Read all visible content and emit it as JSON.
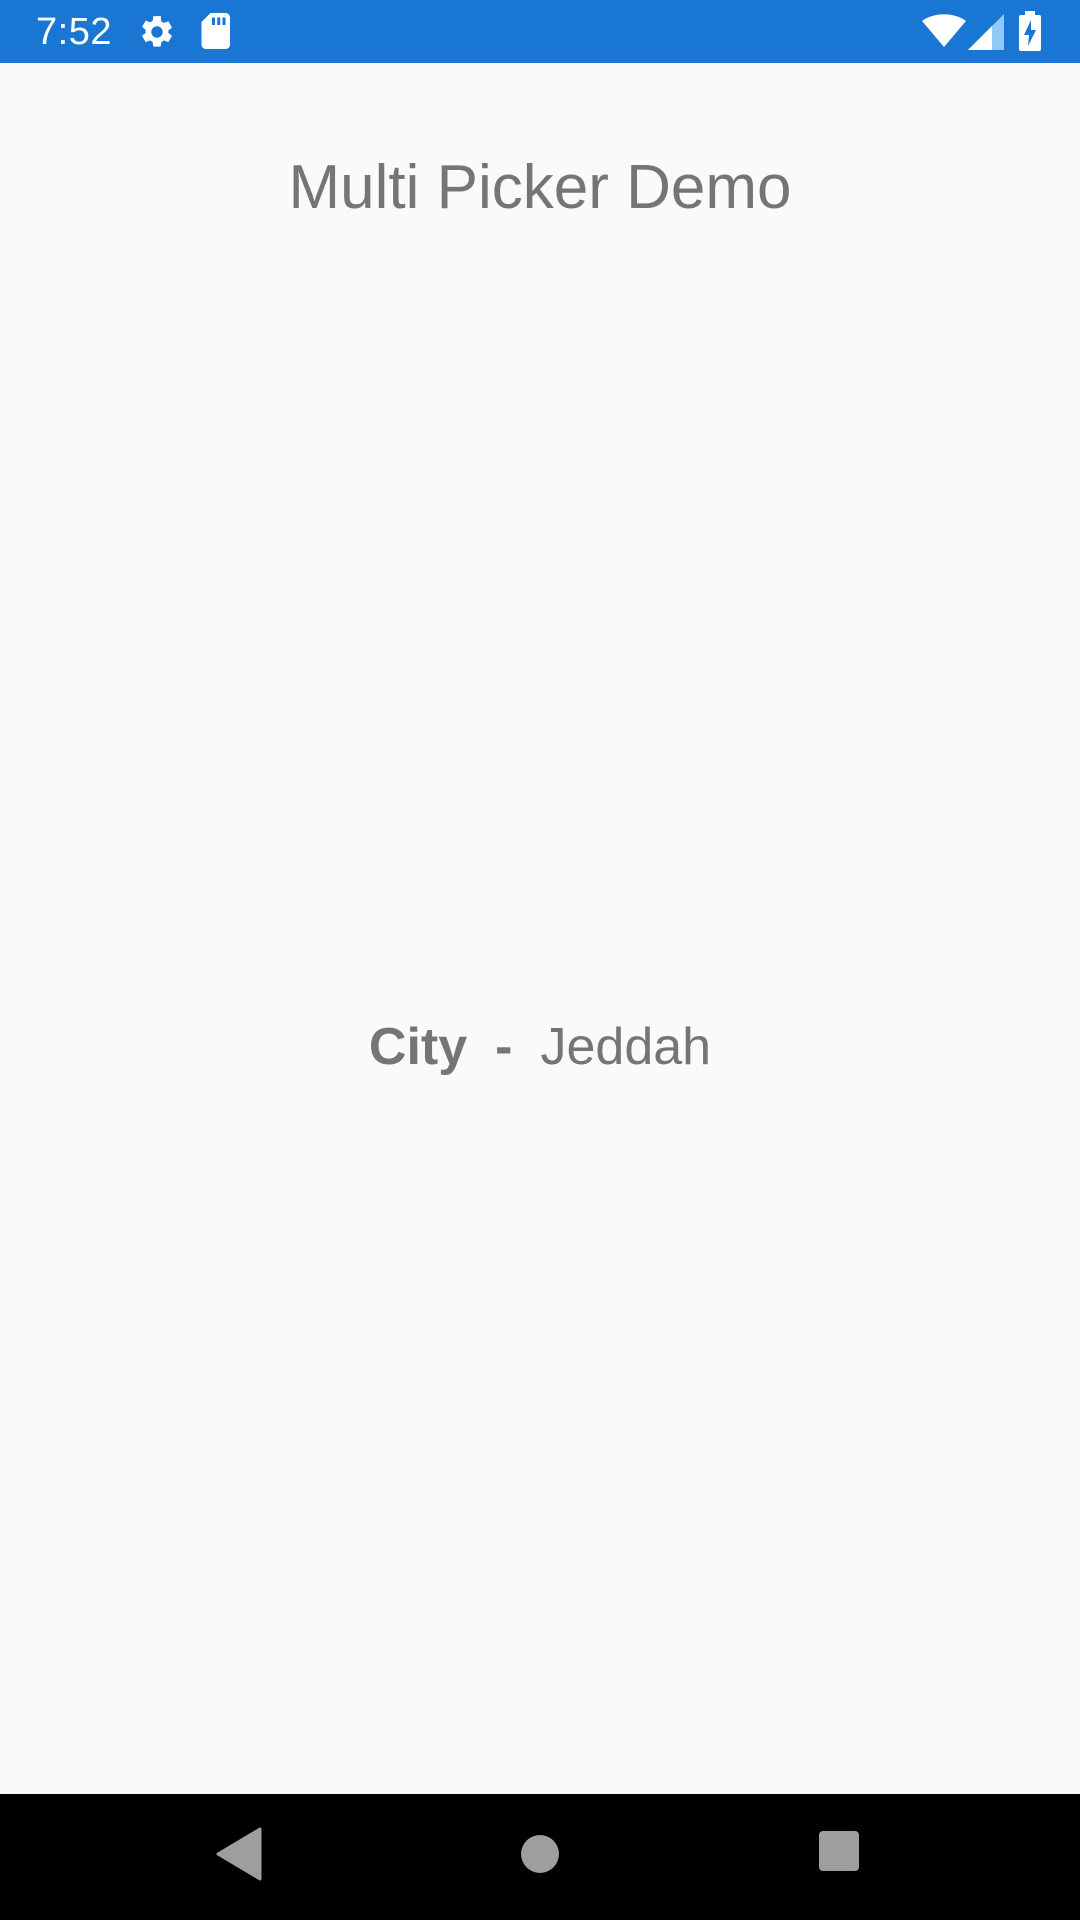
{
  "status_bar": {
    "time": "7:52",
    "background_color": "#1976d2",
    "left_icons": [
      "gear-icon",
      "sd-card-icon"
    ],
    "right_icons": [
      "wifi-icon",
      "cellular-signal-icon",
      "battery-charging-icon"
    ]
  },
  "header": {
    "title": "Multi Picker Demo"
  },
  "picker": {
    "label": "City",
    "separator": "-",
    "selected_value": "Jeddah"
  },
  "nav_bar": {
    "buttons": [
      "back-icon",
      "home-icon",
      "recents-icon"
    ]
  },
  "colors": {
    "text": "#757575",
    "background": "#fafafa",
    "nav_bar": "#000000",
    "nav_icons": "#9e9e9e"
  }
}
